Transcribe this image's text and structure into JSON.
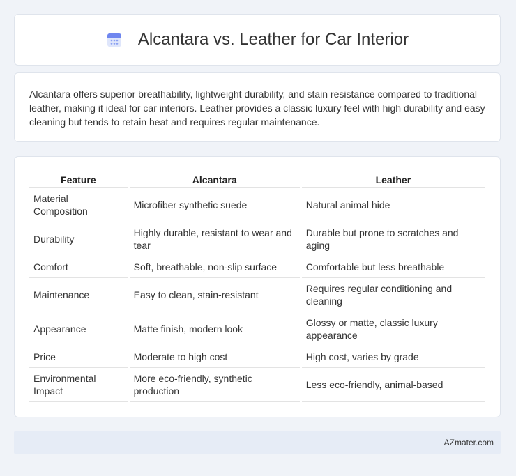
{
  "header": {
    "title": "Alcantara vs. Leather for Car Interior",
    "icon": "calendar-icon"
  },
  "summary": {
    "text": "Alcantara offers superior breathability, lightweight durability, and stain resistance compared to traditional leather, making it ideal for car interiors. Leather provides a classic luxury feel with high durability and easy cleaning but tends to retain heat and requires regular maintenance."
  },
  "table": {
    "headers": [
      "Feature",
      "Alcantara",
      "Leather"
    ],
    "rows": [
      [
        "Material Composition",
        "Microfiber synthetic suede",
        "Natural animal hide"
      ],
      [
        "Durability",
        "Highly durable, resistant to wear and tear",
        "Durable but prone to scratches and aging"
      ],
      [
        "Comfort",
        "Soft, breathable, non-slip surface",
        "Comfortable but less breathable"
      ],
      [
        "Maintenance",
        "Easy to clean, stain-resistant",
        "Requires regular conditioning and cleaning"
      ],
      [
        "Appearance",
        "Matte finish, modern look",
        "Glossy or matte, classic luxury appearance"
      ],
      [
        "Price",
        "Moderate to high cost",
        "High cost, varies by grade"
      ],
      [
        "Environmental Impact",
        "More eco-friendly, synthetic production",
        "Less eco-friendly, animal-based"
      ]
    ]
  },
  "footer": {
    "site": "AZmater.com"
  },
  "colors": {
    "background": "#f0f3f8",
    "card": "#ffffff",
    "footer": "#e6ecf6",
    "icon_accent": "#7b8cf0"
  }
}
